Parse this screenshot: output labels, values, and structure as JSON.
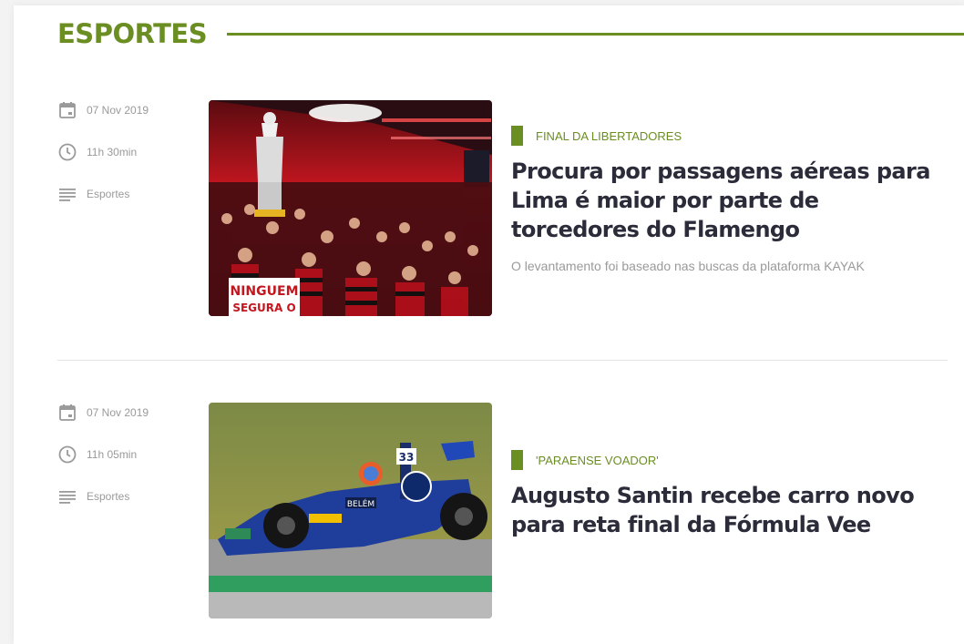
{
  "section": {
    "title": "ESPORTES"
  },
  "colors": {
    "accent": "#6b8e23",
    "headline": "#2b2b3a",
    "meta": "#9a9a9a"
  },
  "articles": [
    {
      "date": "07 Nov 2019",
      "time": "11h 30min",
      "category_name": "Esportes",
      "tag": "FINAL DA LIBERTADORES",
      "headline": "Procura por passagens aéreas para Lima é maior por parte de torcedores do Flamengo",
      "summary": "O levantamento foi baseado nas buscas da plataforma KAYAK",
      "image": {
        "banner_line1": "NINGUEM",
        "banner_line2": "SEGURA O"
      }
    },
    {
      "date": "07 Nov 2019",
      "time": "11h 05min",
      "category_name": "Esportes",
      "tag": "'PARAENSE VOADOR'",
      "headline": "Augusto Santin recebe carro novo para reta final da Fórmula Vee",
      "summary": "",
      "image": {
        "car_number": "33",
        "sponsor": "BELÉM"
      }
    }
  ]
}
